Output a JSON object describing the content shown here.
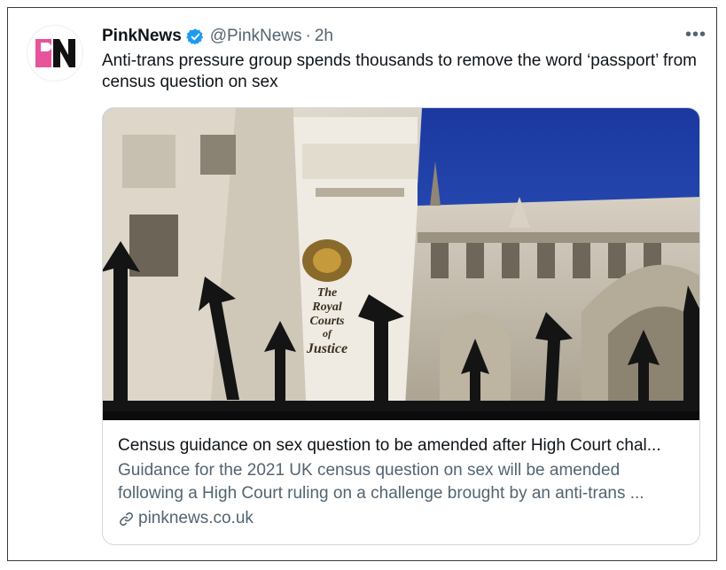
{
  "tweet": {
    "author_name": "PinkNews",
    "handle": "@PinkNews",
    "separator": "·",
    "time": "2h",
    "more_label": "•••",
    "text": "Anti-trans pressure group spends thousands to remove the word ‘passport’ from census question on sex",
    "avatar_letters": "PN",
    "verified_icon": "verified-badge-icon"
  },
  "card": {
    "title": "Census guidance on sex question to be amended after High Court chal...",
    "description": "Guidance for the 2021 UK census question on sex will be amended following a High Court ruling on a challenge brought by an anti-trans ...",
    "domain": "pinknews.co.uk",
    "image_sign_text": "The Royal Courts of Justice",
    "link_icon": "link-icon"
  },
  "colors": {
    "brand_pink": "#e8549b",
    "verified_blue": "#1d9bf0",
    "text_secondary": "#536471",
    "sky_blue": "#1d3fa8"
  }
}
